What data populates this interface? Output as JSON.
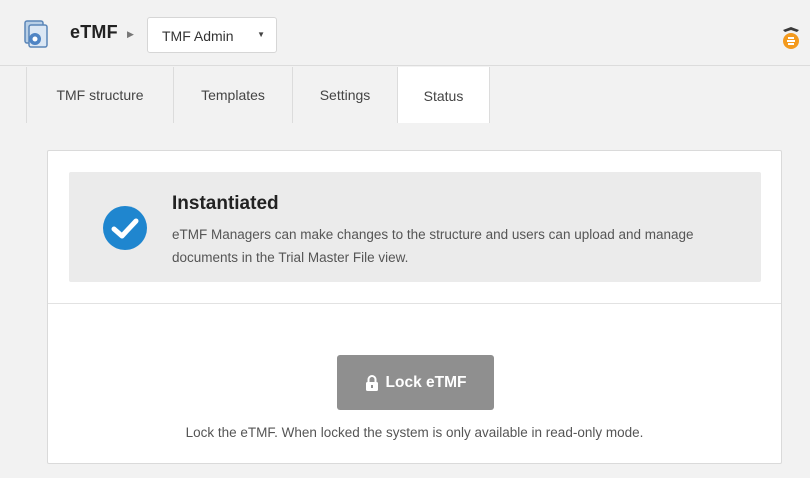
{
  "header": {
    "app_name": "eTMF",
    "role_selector": {
      "value": "TMF Admin"
    }
  },
  "tabs": [
    {
      "label": "TMF structure",
      "active": false
    },
    {
      "label": "Templates",
      "active": false
    },
    {
      "label": "Settings",
      "active": false
    },
    {
      "label": "Status",
      "active": true
    }
  ],
  "status": {
    "title": "Instantiated",
    "description": "eTMF Managers can make changes to the structure and users can upload and manage documents in the Trial Master File view."
  },
  "lock": {
    "button_label": "Lock eTMF",
    "help_text": "Lock the eTMF. When locked the system is only available in read-only mode."
  },
  "colors": {
    "check_blue": "#1f86cf",
    "button_gray": "#8f8f8f",
    "logo_orange": "#f39a1e"
  },
  "icons": {
    "app": "etmf-app-icon",
    "breadcrumb_separator": "caret-right-icon",
    "dropdown": "caret-down-icon",
    "brand": "brand-logo-icon",
    "status": "check-circle-icon",
    "button": "lock-icon"
  }
}
